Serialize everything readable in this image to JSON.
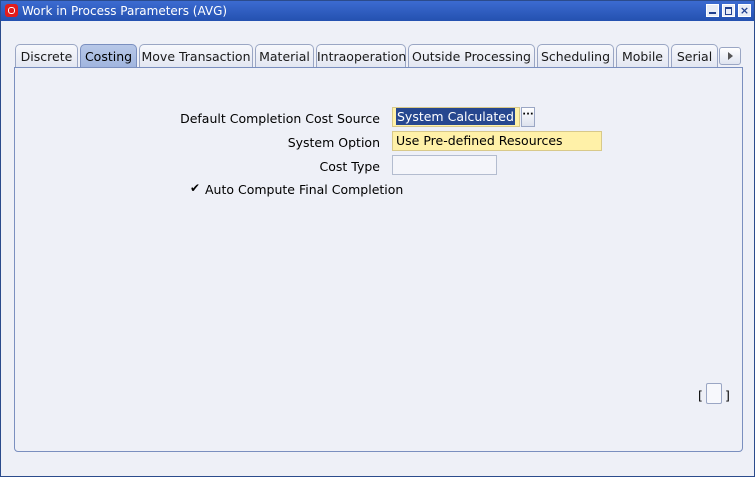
{
  "window": {
    "title": "Work in Process Parameters (AVG)"
  },
  "tabs": [
    {
      "label": "Discrete"
    },
    {
      "label": "Costing"
    },
    {
      "label": "Move Transaction"
    },
    {
      "label": "Material"
    },
    {
      "label": "Intraoperation"
    },
    {
      "label": "Outside Processing"
    },
    {
      "label": "Scheduling"
    },
    {
      "label": "Mobile"
    },
    {
      "label": "Serial"
    }
  ],
  "active_tab": "Costing",
  "form": {
    "default_completion_cost_source_label": "Default Completion Cost Source",
    "default_completion_cost_source_value": "System Calculated",
    "system_option_label": "System Option",
    "system_option_value": "Use Pre-defined Resources",
    "cost_type_label": "Cost Type",
    "cost_type_value": "",
    "auto_compute_label": "Auto Compute Final Completion",
    "auto_compute_checked": true,
    "check_glyph": "✔",
    "lov_glyph": "···",
    "bracket_left": "[",
    "bracket_right": "]"
  },
  "colors": {
    "titlebar": "#2451b0",
    "required_field": "#fff1a8",
    "active_tab": "#9fb4de"
  }
}
